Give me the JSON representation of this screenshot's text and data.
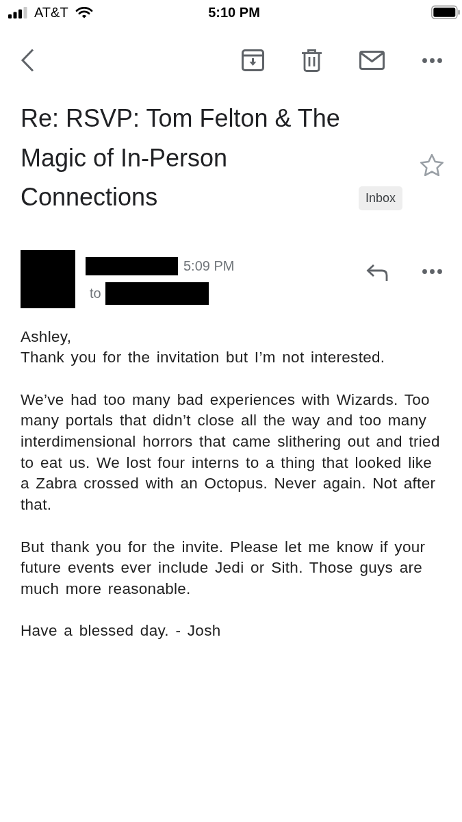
{
  "status_bar": {
    "carrier": "AT&T",
    "time": "5:10 PM"
  },
  "email": {
    "subject": "Re: RSVP: Tom Felton & The Magic of In-Person Connections",
    "label": "Inbox",
    "starred": false,
    "message": {
      "time": "5:09 PM",
      "to_label": "to",
      "body": [
        {
          "lines": [
            "Ashley,",
            "Thank you for the invitation but I’m not interested."
          ]
        },
        {
          "lines": [
            "We’ve had too many bad experiences with Wizards. Too many portals that didn’t close all the way and too many interdimensional horrors that came slithering out and tried to eat us. We lost four interns to a thing that looked like a Zabra crossed with an Octopus. Never again. Not after that."
          ]
        },
        {
          "lines": [
            "But thank you for the invite. Please let me know if your future events ever include Jedi or Sith. Those guys are much more reasonable."
          ]
        },
        {
          "lines": [
            "Have a blessed day. - Josh"
          ]
        }
      ]
    }
  }
}
